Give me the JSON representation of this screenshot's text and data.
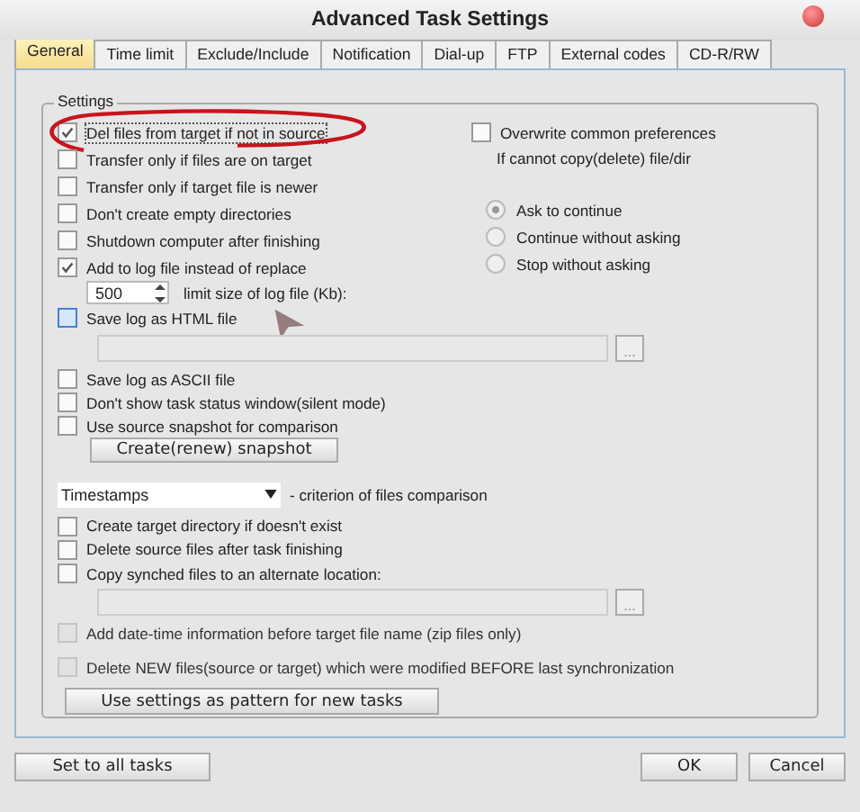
{
  "window": {
    "title": "Advanced Task Settings"
  },
  "tabs": [
    {
      "label": "General",
      "selected": true
    },
    {
      "label": "Time limit",
      "selected": false
    },
    {
      "label": "Exclude/Include",
      "selected": false
    },
    {
      "label": "Notification",
      "selected": false
    },
    {
      "label": "Dial-up",
      "selected": false
    },
    {
      "label": "FTP",
      "selected": false
    },
    {
      "label": "External codes",
      "selected": false
    },
    {
      "label": "CD-R/RW",
      "selected": false
    }
  ],
  "group": {
    "title": "Settings"
  },
  "left_options": [
    {
      "kind": "checkbox",
      "label": "Del files from target if not in source",
      "checked": true,
      "disabled": false,
      "focused": false,
      "circled": true
    },
    {
      "kind": "checkbox",
      "label": "Transfer only if files are on target",
      "checked": false,
      "disabled": false,
      "focused": false,
      "circled": false
    },
    {
      "kind": "checkbox",
      "label": "Transfer only if target file is newer",
      "checked": false,
      "disabled": false,
      "focused": false,
      "circled": false
    },
    {
      "kind": "checkbox",
      "label": "Don't create empty directories",
      "checked": false,
      "disabled": false,
      "focused": false,
      "circled": false
    },
    {
      "kind": "checkbox",
      "label": "Shutdown computer after finishing",
      "checked": false,
      "disabled": false,
      "focused": false,
      "circled": false
    },
    {
      "kind": "checkbox",
      "label": "Add to log file instead of replace",
      "checked": true,
      "disabled": false,
      "focused": false,
      "circled": false
    },
    {
      "kind": "spinner",
      "value": "500",
      "note": "limit size of log file (Kb):"
    },
    {
      "kind": "checkbox",
      "label": "Save log as HTML file",
      "checked": false,
      "disabled": false,
      "focused": true,
      "circled": false
    }
  ],
  "right": {
    "overwrite": {
      "label": "Overwrite common preferences",
      "checked": false
    },
    "caption": "If cannot copy(delete) file/dir",
    "radios": [
      {
        "label": "Ask to continue",
        "selected": true
      },
      {
        "label": "Continue without asking",
        "selected": false
      },
      {
        "label": "Stop without asking",
        "selected": false
      }
    ]
  },
  "options": [
    {
      "kind": "path",
      "browse": "..."
    },
    {
      "kind": "checkbox",
      "label": "Save log as ASCII file",
      "checked": false,
      "disabled": false
    },
    {
      "kind": "checkbox",
      "label": "Don't show task status window(silent mode)",
      "checked": false,
      "disabled": false
    },
    {
      "kind": "checkbox",
      "label": "Use source snapshot for comparison",
      "checked": false,
      "disabled": false
    },
    {
      "kind": "button",
      "label": "Create(renew) snapshot"
    },
    {
      "kind": "select",
      "value": "Timestamps",
      "note": "- criterion of files comparison"
    },
    {
      "kind": "checkbox",
      "label": "Create target directory if doesn't exist",
      "checked": false,
      "disabled": false
    },
    {
      "kind": "checkbox",
      "label": "Delete source files after task finishing",
      "checked": false,
      "disabled": false
    },
    {
      "kind": "checkbox",
      "label": "Copy synched files to an alternate location:",
      "checked": false,
      "disabled": false
    },
    {
      "kind": "path",
      "browse": "..."
    },
    {
      "kind": "checkbox",
      "label": "Add date-time information before target file name (zip files only)",
      "checked": false,
      "disabled": true
    },
    {
      "kind": "checkbox",
      "label": "Delete NEW files(source or target) which were modified BEFORE last synchronization",
      "checked": false,
      "disabled": true
    },
    {
      "kind": "wide-button",
      "label": "Use settings as pattern for new tasks"
    }
  ],
  "buttons": {
    "left": "Set to all tasks",
    "ok": "OK",
    "cancel": "Cancel"
  }
}
